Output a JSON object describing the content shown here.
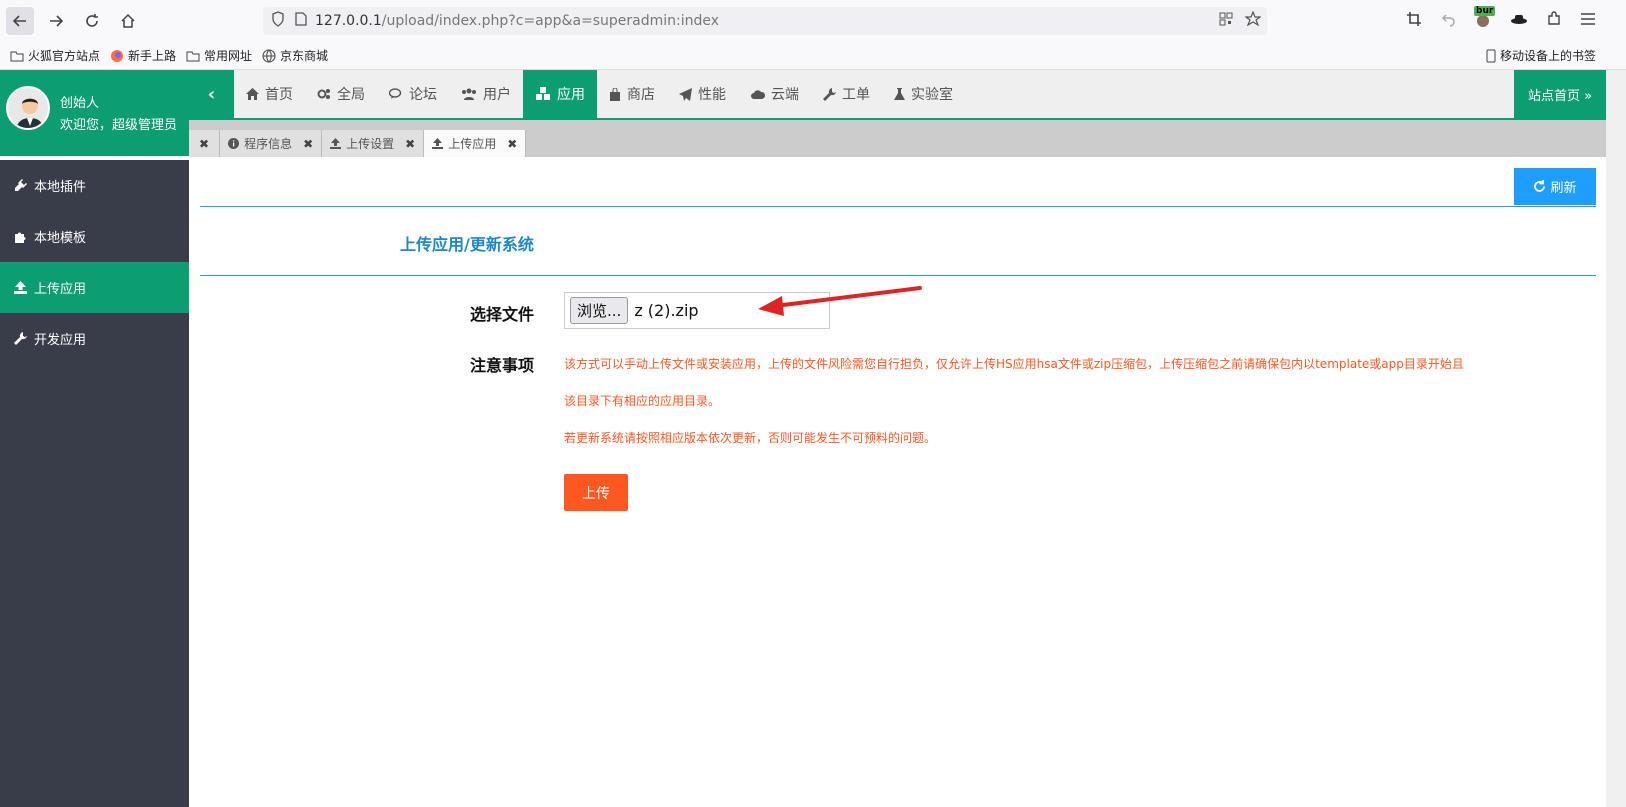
{
  "browser": {
    "url_host": "127.0.0.1",
    "url_path": "/upload/index.php?c=app&a=superadmin:index",
    "burp_label": "bur",
    "bookmarks": [
      "火狐官方站点",
      "新手上路",
      "常用网址",
      "京东商城"
    ],
    "mobile_bookmarks": "移动设备上的书签"
  },
  "user": {
    "name": "创始人",
    "welcome": "欢迎您，超级管理员"
  },
  "topnav": {
    "items": [
      {
        "label": "首页",
        "icon": "home-icon"
      },
      {
        "label": "全局",
        "icon": "gears-icon"
      },
      {
        "label": "论坛",
        "icon": "comments-icon"
      },
      {
        "label": "用户",
        "icon": "users-icon"
      },
      {
        "label": "应用",
        "icon": "cubes-icon",
        "active": true
      },
      {
        "label": "商店",
        "icon": "shopping-bag-icon"
      },
      {
        "label": "性能",
        "icon": "paper-plane-icon"
      },
      {
        "label": "云端",
        "icon": "cloud-icon"
      },
      {
        "label": "工单",
        "icon": "wrench-icon"
      },
      {
        "label": "实验室",
        "icon": "flask-icon"
      }
    ],
    "site_home": "站点首页 »"
  },
  "tabs": [
    {
      "label": "程序信息",
      "icon": "info-icon"
    },
    {
      "label": "上传设置",
      "icon": "upload-icon"
    },
    {
      "label": "上传应用",
      "icon": "upload-icon",
      "active": true
    }
  ],
  "sidebar": {
    "items": [
      {
        "label": "本地插件",
        "icon": "plug-icon"
      },
      {
        "label": "本地模板",
        "icon": "puzzle-icon"
      },
      {
        "label": "上传应用",
        "icon": "upload-icon",
        "active": true
      },
      {
        "label": "开发应用",
        "icon": "wrench-icon"
      }
    ]
  },
  "content": {
    "refresh_label": "刷新",
    "section_title": "上传应用/更新系统",
    "file_label": "选择文件",
    "browse_label": "浏览...",
    "file_name": "z (2).zip",
    "notes_label": "注意事项",
    "notes": [
      "该方式可以手动上传文件或安装应用，上传的文件风险需您自行担负，仅允许上传HS应用hsa文件或zip压缩包，上传压缩包之前请确保包内以template或app目录开始且",
      "该目录下有相应的应用目录。",
      "若更新系统请按照相应版本依次更新，否则可能发生不可预料的问题。"
    ],
    "upload_label": "上传"
  },
  "colors": {
    "brand": "#0c9d73",
    "sidebar": "#393d49",
    "accent": "#1e9fff",
    "warn": "#ff5722"
  }
}
